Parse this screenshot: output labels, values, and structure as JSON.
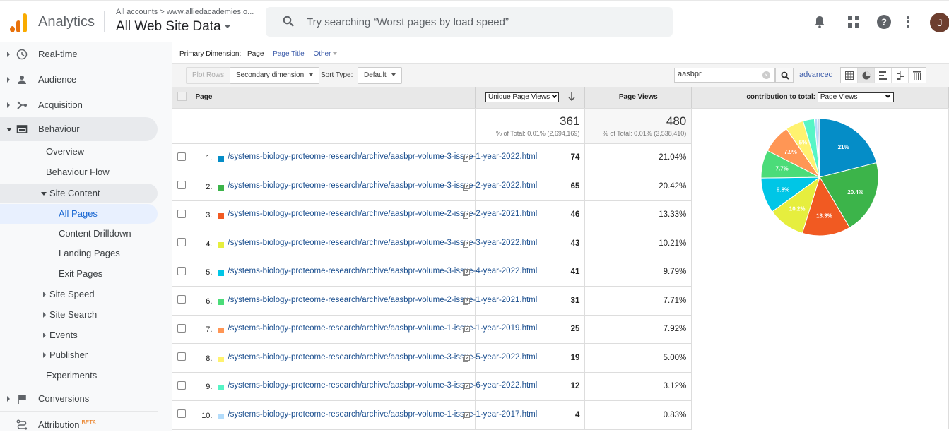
{
  "header": {
    "app_name": "Analytics",
    "breadcrumb": "All accounts > www.alliedacademies.o...",
    "property": "All Web Site Data",
    "search_placeholder": "Try searching “Worst pages by load speed”",
    "avatar_initial": "J",
    "icons": [
      "bell-icon",
      "apps-grid-icon",
      "help-icon",
      "more-vert-icon"
    ]
  },
  "sidebar": {
    "items": [
      {
        "label": "Real-time",
        "icon": "clock-icon"
      },
      {
        "label": "Audience",
        "icon": "person-icon"
      },
      {
        "label": "Acquisition",
        "icon": "acquisition-icon"
      },
      {
        "label": "Behaviour",
        "icon": "behaviour-icon"
      }
    ],
    "behaviour_sub": {
      "overview": "Overview",
      "flow": "Behaviour Flow",
      "site_content": "Site Content",
      "all_pages": "All Pages",
      "drilldown": "Content Drilldown",
      "landing": "Landing Pages",
      "exit": "Exit Pages",
      "site_speed": "Site Speed",
      "site_search": "Site Search",
      "events": "Events",
      "publisher": "Publisher",
      "experiments": "Experiments"
    },
    "conversions": "Conversions",
    "attribution": "Attribution",
    "attribution_badge": "BETA"
  },
  "report": {
    "primary_dimension_label": "Primary Dimension:",
    "primary_dimension_current": "Page",
    "primary_dimension_options": [
      "Page Title",
      "Other"
    ],
    "plot_rows": "Plot Rows",
    "secondary_dimension": "Secondary dimension",
    "sort_type_label": "Sort Type:",
    "sort_type_value": "Default",
    "filter_value": "aasbpr",
    "advanced": "advanced",
    "columns": {
      "page": "Page",
      "metric1": "Unique Page Views",
      "metric2": "Page Views",
      "contribution_label": "contribution to total:",
      "contribution_metric": "Page Views"
    },
    "totals": {
      "metric1_value": "361",
      "metric1_pct": "% of Total: 0.01% (2,694,169)",
      "metric2_value": "480",
      "metric2_pct": "% of Total: 0.01% (3,538,410)"
    },
    "rows": [
      {
        "n": "1.",
        "page": "/systems-biology-proteome-research/archive/aasbpr-volume-3-issue-1-year-2022.html",
        "upv": "74",
        "pv": "21.04%",
        "color": "#058dc7"
      },
      {
        "n": "2.",
        "page": "/systems-biology-proteome-research/archive/aasbpr-volume-3-issue-2-year-2022.html",
        "upv": "65",
        "pv": "20.42%",
        "color": "#3cb44a"
      },
      {
        "n": "3.",
        "page": "/systems-biology-proteome-research/archive/aasbpr-volume-2-issue-2-year-2021.html",
        "upv": "46",
        "pv": "13.33%",
        "color": "#f15a22"
      },
      {
        "n": "4.",
        "page": "/systems-biology-proteome-research/archive/aasbpr-volume-3-issue-3-year-2022.html",
        "upv": "43",
        "pv": "10.21%",
        "color": "#e6ee3e"
      },
      {
        "n": "5.",
        "page": "/systems-biology-proteome-research/archive/aasbpr-volume-3-issue-4-year-2022.html",
        "upv": "41",
        "pv": "9.79%",
        "color": "#00c6e6"
      },
      {
        "n": "6.",
        "page": "/systems-biology-proteome-research/archive/aasbpr-volume-2-issue-1-year-2021.html",
        "upv": "31",
        "pv": "7.71%",
        "color": "#4bdc79"
      },
      {
        "n": "7.",
        "page": "/systems-biology-proteome-research/archive/aasbpr-volume-1-issue-1-year-2019.html",
        "upv": "25",
        "pv": "7.92%",
        "color": "#ff9655"
      },
      {
        "n": "8.",
        "page": "/systems-biology-proteome-research/archive/aasbpr-volume-3-issue-5-year-2022.html",
        "upv": "19",
        "pv": "5.00%",
        "color": "#fff26f"
      },
      {
        "n": "9.",
        "page": "/systems-biology-proteome-research/archive/aasbpr-volume-3-issue-6-year-2022.html",
        "upv": "12",
        "pv": "3.12%",
        "color": "#56f5c6"
      },
      {
        "n": "10.",
        "page": "/systems-biology-proteome-research/archive/aasbpr-volume-1-issue-1-year-2017.html",
        "upv": "4",
        "pv": "0.83%",
        "color": "#b3dcfb"
      }
    ]
  },
  "chart_data": {
    "type": "pie",
    "title": "contribution to total: Page Views",
    "categories": [
      "vol-3-issue-1-2022",
      "vol-3-issue-2-2022",
      "vol-2-issue-2-2021",
      "vol-3-issue-3-2022",
      "vol-3-issue-4-2022",
      "vol-2-issue-1-2021",
      "vol-1-issue-1-2019",
      "vol-3-issue-5-2022",
      "vol-3-issue-6-2022",
      "vol-1-issue-1-2017",
      "other"
    ],
    "values": [
      21.04,
      20.42,
      13.33,
      10.21,
      9.79,
      7.71,
      7.92,
      5.0,
      3.12,
      0.83,
      0.63
    ],
    "labels": [
      "21%",
      "20.4%",
      "13.3%",
      "10.2%",
      "9.8%",
      "7.7%",
      "7.9%",
      "5%",
      "",
      "",
      ""
    ],
    "colors": [
      "#058dc7",
      "#3cb44a",
      "#f15a22",
      "#e6ee3e",
      "#00c6e6",
      "#4bdc79",
      "#ff9655",
      "#fff26f",
      "#56f5c6",
      "#b3dcfb",
      "#c9d6e8"
    ]
  }
}
